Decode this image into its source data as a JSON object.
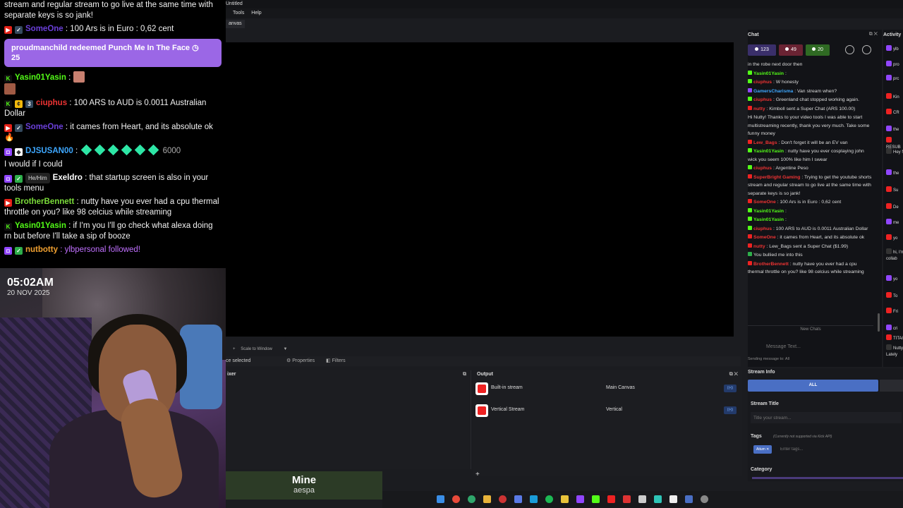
{
  "overlay_chat": {
    "lines": [
      {
        "user": "",
        "text": "stream and regular stream to go live at the same time with separate keys is so jank!"
      },
      {
        "user": "SomeOne",
        "text": ": 100 Ars is in Euro : 0,62 cent"
      },
      {
        "user": "Yasin01Yasin",
        "text": ":"
      },
      {
        "user": "ciuphus",
        "text": ": 100 ARS to AUD is 0.0011 Australian Dollar"
      },
      {
        "user": "SomeOne",
        "text": ": it cames from Heart, and its absolute ok"
      },
      {
        "user": "DJSUSAN00",
        "text": ":",
        "amount": "6000"
      },
      {
        "user": "",
        "text": "I would if I could"
      },
      {
        "user": "Exeldro",
        "pronoun": "He/Him",
        "text": ": that startup screen is also in your tools menu"
      },
      {
        "user": "BrotherBennett",
        "text": ": nutty have you ever had a cpu thermal throttle on you? like 98 celcius while streaming"
      },
      {
        "user": "Yasin01Yasin",
        "text": ": if I'm you I'll go check what alexa doing rn but before I'll take a sip of booze"
      },
      {
        "user": "nutbotty",
        "text": ": ylbpersonal followed!"
      }
    ],
    "redeem": {
      "text": "proudmanchild redeemed Punch Me In The Face",
      "cost": "25"
    }
  },
  "webcam": {
    "time": "05:02AM",
    "date": "20 NOV 2025"
  },
  "now_playing": {
    "title": "Mine",
    "artist": "aespa"
  },
  "app": {
    "title": "Untitled",
    "menu": [
      "Tools",
      "Help"
    ],
    "canvas_tab": "anvas",
    "preview_bar": {
      "plus": "+",
      "scale": "Scale to Window",
      "arrow": "▼"
    },
    "sources_bar": {
      "selected": "ce selected",
      "properties": "Properties",
      "filters": "Filters"
    },
    "mixer": {
      "title": "ixer"
    },
    "output": {
      "title": "Output",
      "rows": [
        {
          "name": "Built-in stream",
          "canvas": "Main Canvas"
        },
        {
          "name": "Vertical Stream",
          "canvas": "Vertical"
        }
      ],
      "add": "+"
    }
  },
  "chat": {
    "title": "Chat",
    "stats": {
      "viewers": "123",
      "watching": "49",
      "kick": "20"
    },
    "messages": [
      {
        "user": "",
        "text": "in the robe next door then"
      },
      {
        "user": "Yasin01Yasin",
        "text": ":"
      },
      {
        "user": "ciuphus",
        "text": ": W honesty"
      },
      {
        "user": "GamersCharisma",
        "text": ": Van stream when?"
      },
      {
        "user": "ciuphus",
        "text": ": Greenland chat stopped working again."
      },
      {
        "user": "nutty",
        "text": ": Kimboll sent a Super Chat (ARS 100.00)"
      },
      {
        "user": "",
        "text": "Hi Nutty! Thanks to your video tools I was able to start multistreaming recently, thank you very much. Take some funny money"
      },
      {
        "user": "Lew_Bags",
        "text": ": Don't forget it will be an EV van"
      },
      {
        "user": "Yasin01Yasin",
        "text": ": nutty have you ever cosplaying john wick you seem 100% like him I swear"
      },
      {
        "user": "ciuphus",
        "text": ": Argentine Peso"
      },
      {
        "user": "SuperBright Gaming",
        "text": ": Trying to get the youtube shorts stream and regular stream to go live at the same time with separate keys is so jank!"
      },
      {
        "user": "SomeOne",
        "text": ": 100 Ars is in Euro : 0,62 cent"
      },
      {
        "user": "Yasin01Yasin",
        "text": ":"
      },
      {
        "user": "Yasin01Yasin",
        "text": ":"
      },
      {
        "user": "ciuphus",
        "text": ": 100 ARS to AUD is 0.0011 Australian Dollar"
      },
      {
        "user": "SomeOne",
        "text": ": it cames from Heart, and its absolute ok"
      },
      {
        "user": "nutty",
        "text": ": Lew_Bags sent a Super Chat ($1.99)"
      },
      {
        "user": "",
        "text": "You bullied me into this"
      },
      {
        "user": "BrotherBennett",
        "text": ": nutty have you ever had a cpu thermal throttle on you? like 98 celcius while streaming"
      }
    ],
    "new_chats": "New Chats",
    "input_placeholder": "Message Text...",
    "sending_to": "Sending message to: All"
  },
  "activity": {
    "title": "Activity",
    "items": [
      "ylb",
      "pro",
      "prc",
      "Kin",
      "CR",
      "the",
      "RESUB",
      "Hey N",
      "the",
      "Su",
      "De",
      "me",
      "yo",
      "hi, I'm collab",
      "yo",
      "To",
      "Fri",
      "cri",
      "TITA/T",
      "Nutty, Lately"
    ]
  },
  "stream_info": {
    "title": "Stream Info",
    "all_tab": "ALL",
    "stream_title_label": "Stream Title",
    "stream_title_placeholder": "Title your stream...",
    "tags_label": "Tags",
    "tags_note": "(Currently not supported via Kick API)",
    "tag": "Aitum",
    "tags_placeholder": "Enter tags...",
    "category_label": "Category"
  }
}
